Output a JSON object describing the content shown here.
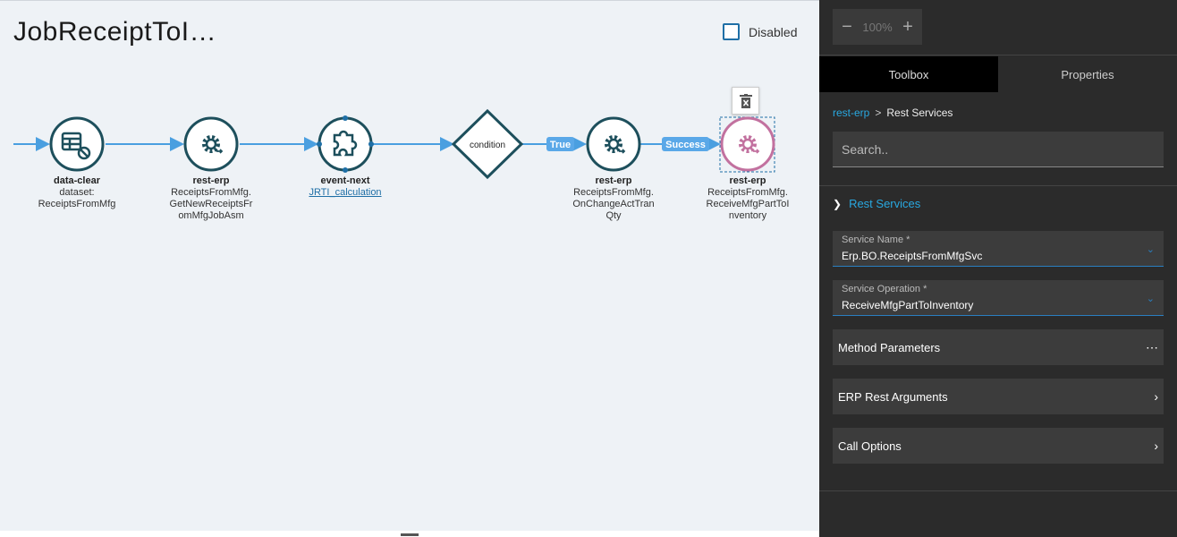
{
  "canvas": {
    "title": "JobReceiptToI…",
    "disabled_label": "Disabled",
    "disabled_checked": false,
    "nodes": [
      {
        "type": "data-clear",
        "lines": [
          "dataset:",
          "ReceiptsFromMfg"
        ],
        "icon": "dataset-clear-icon"
      },
      {
        "type": "rest-erp",
        "lines": [
          "ReceiptsFromMfg.",
          "GetNewReceiptsFr",
          "omMfgJobAsm"
        ],
        "icon": "rest-service-icon"
      },
      {
        "type": "event-next",
        "link": "JRTI_calculation",
        "icon": "puzzle-icon"
      },
      {
        "type": "condition",
        "label": "condition"
      },
      {
        "type": "rest-erp",
        "lines": [
          "ReceiptsFromMfg.",
          "OnChangeActTran",
          "Qty"
        ],
        "icon": "rest-service-icon"
      },
      {
        "type": "rest-erp",
        "lines": [
          "ReceiptsFromMfg.",
          "ReceiveMfgPartToI",
          "nventory"
        ],
        "icon": "rest-service-icon",
        "selected": true
      }
    ],
    "edge_labels": {
      "true_label": "True",
      "success_label": "Success"
    },
    "colors": {
      "node_stroke": "#1d4f5c",
      "edge": "#4a9fe0",
      "selected_node": "#c2719f",
      "edge_badge": "#5aa8e8"
    }
  },
  "panel": {
    "zoom": {
      "minus": "−",
      "value": "100%",
      "plus": "+"
    },
    "tabs": [
      {
        "label": "Toolbox",
        "active": true
      },
      {
        "label": "Properties",
        "active": false
      }
    ],
    "breadcrumb": {
      "parent": "rest-erp",
      "separator": ">",
      "current": "Rest Services"
    },
    "search_placeholder": "Search..",
    "section": "Rest Services",
    "fields": [
      {
        "label": "Service Name *",
        "value": "Erp.BO.ReceiptsFromMfgSvc"
      },
      {
        "label": "Service Operation *",
        "value": "ReceiveMfgPartToInventory"
      }
    ],
    "groups": [
      {
        "label": "Method Parameters",
        "icon": "more-icon"
      },
      {
        "label": "ERP Rest Arguments",
        "icon": "chevron-right-icon"
      },
      {
        "label": "Call Options",
        "icon": "chevron-right-icon"
      }
    ],
    "colors": {
      "accent": "#29a8e0",
      "background": "#2b2b2b"
    }
  }
}
